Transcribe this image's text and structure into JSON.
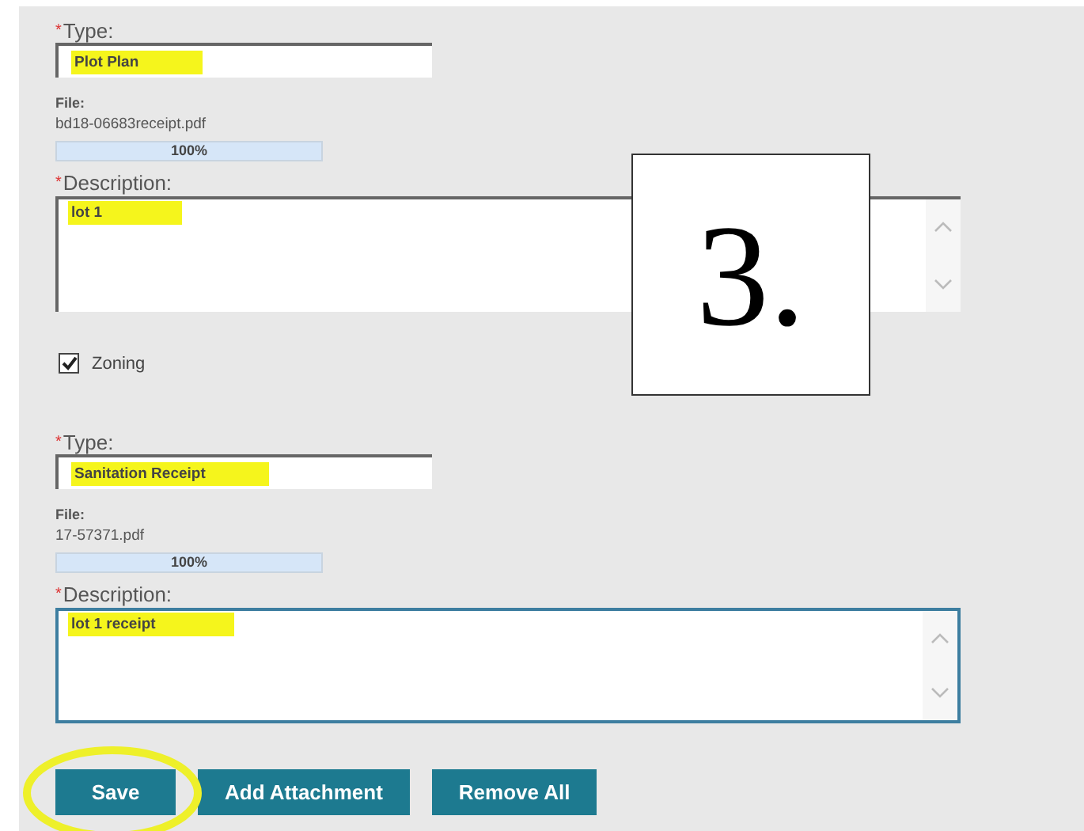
{
  "attachments": [
    {
      "required_mark": "*",
      "type_label": "Type:",
      "type_value": "Plot Plan",
      "type_highlighted": true,
      "file_label": "File:",
      "file_name": "bd18-06683receipt.pdf",
      "level": 1,
      "reading": "100%",
      "description_label": "Description:",
      "description": "lot 1",
      "description_highlighted": true,
      "focused": false,
      "checkbox": {
        "label": "Zoning",
        "checked": true
      }
    },
    {
      "required_mark": "*",
      "type_label": "Type:",
      "type_value": "Sanitation Receipt",
      "type_highlighted": true,
      "file_label": "File:",
      "file_name": "17-57371.pdf",
      "level": 1,
      "reading": "100%",
      "description_label": "Description:",
      "description": "lot 1 receipt",
      "description_highlighted": true,
      "focused": true
    }
  ],
  "buttons": [
    {
      "label": "Save",
      "circled": true
    },
    {
      "label": "Add Attachment",
      "circled": false
    },
    {
      "label": "Remove All",
      "circled": false
    }
  ],
  "step_label": "3."
}
